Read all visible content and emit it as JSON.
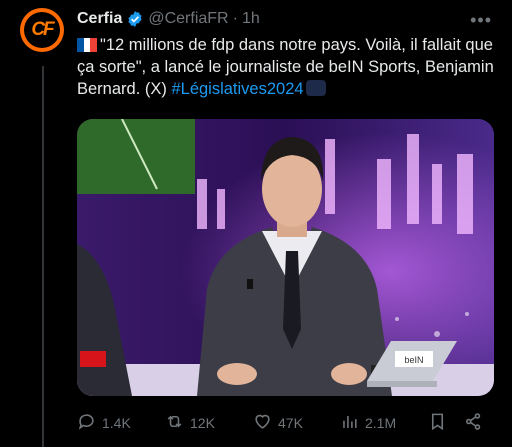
{
  "author": {
    "name": "Cerfia",
    "handle": "@CerfiaFR",
    "separator": "·",
    "time": "1h",
    "avatar_text": "CF"
  },
  "tweet": {
    "text": "\"12 millions de fdp dans notre pays. Voilà, il fallait que ça sorte\", a lancé le journaliste de beIN Sports, Benjamin Bernard. (X)",
    "hashtag": "#Législatives2024"
  },
  "media": {
    "laptop_brand": "beIN"
  },
  "actions": {
    "replies": "1.4K",
    "reposts": "12K",
    "likes": "47K",
    "views": "2.1M"
  },
  "icons": [
    "more-icon",
    "verified-icon",
    "france-flag-icon",
    "reply-icon",
    "repost-icon",
    "like-icon",
    "views-icon",
    "bookmark-icon",
    "share-icon"
  ],
  "colors": {
    "accent": "#1d9bf0",
    "muted": "#71767b",
    "brand": "#ff6a00"
  }
}
